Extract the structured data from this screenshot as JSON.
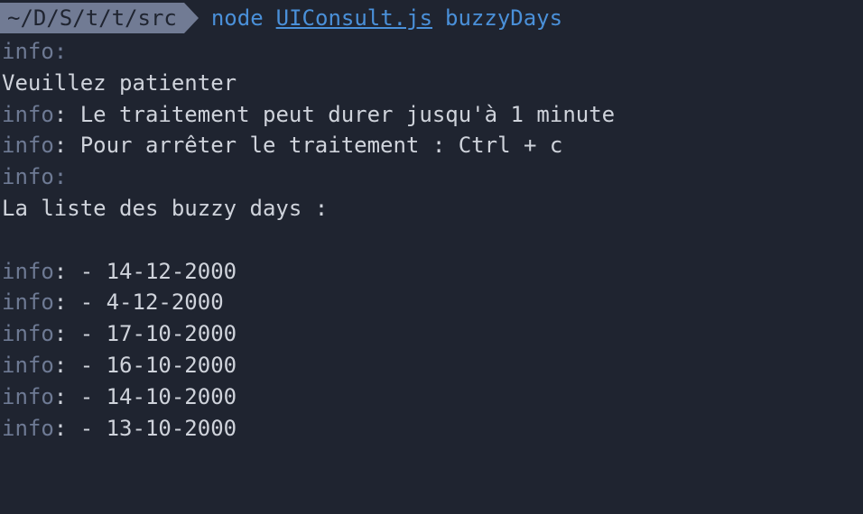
{
  "prompt": {
    "path": " ~/D/S/t/t/src ",
    "node": "node",
    "file": "UIConsult.js",
    "arg": "buzzyDays"
  },
  "output": {
    "info_label": "info",
    "colon_sep": ": ",
    "colon_only": ":",
    "wait_msg": "Veuillez patienter",
    "msg1": "Le traitement peut durer jusqu'à 1 minute",
    "msg2": "Pour arrêter le traitement : Ctrl + c",
    "list_header": "La liste des buzzy days :",
    "dates": {
      "d0": "- 14-12-2000",
      "d1": "- 4-12-2000",
      "d2": "- 17-10-2000",
      "d3": "- 16-10-2000",
      "d4": "- 14-10-2000",
      "d5": "- 13-10-2000"
    }
  }
}
